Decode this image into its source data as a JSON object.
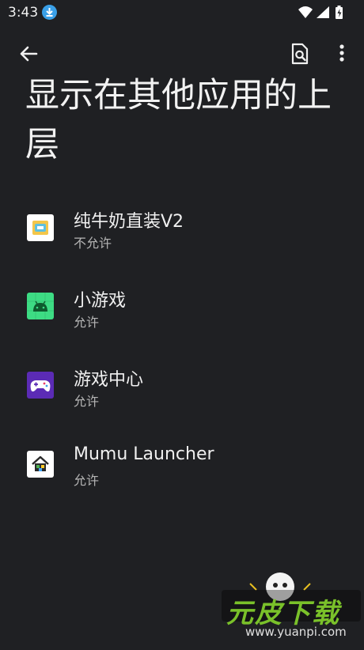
{
  "status_bar": {
    "time": "3:43"
  },
  "header": {
    "title": "显示在其他应用的上层"
  },
  "apps": [
    {
      "name": "纯牛奶直装V2",
      "status": "不允许",
      "icon": "milk-app-icon"
    },
    {
      "name": "小游戏",
      "status": "允许",
      "icon": "android-icon"
    },
    {
      "name": "游戏中心",
      "status": "允许",
      "icon": "gamepad-icon"
    },
    {
      "name": "Mumu Launcher",
      "status": "允许",
      "icon": "house-icon"
    }
  ],
  "watermark": {
    "brand": "元皮下载",
    "url": "www.yuanpi.com"
  }
}
